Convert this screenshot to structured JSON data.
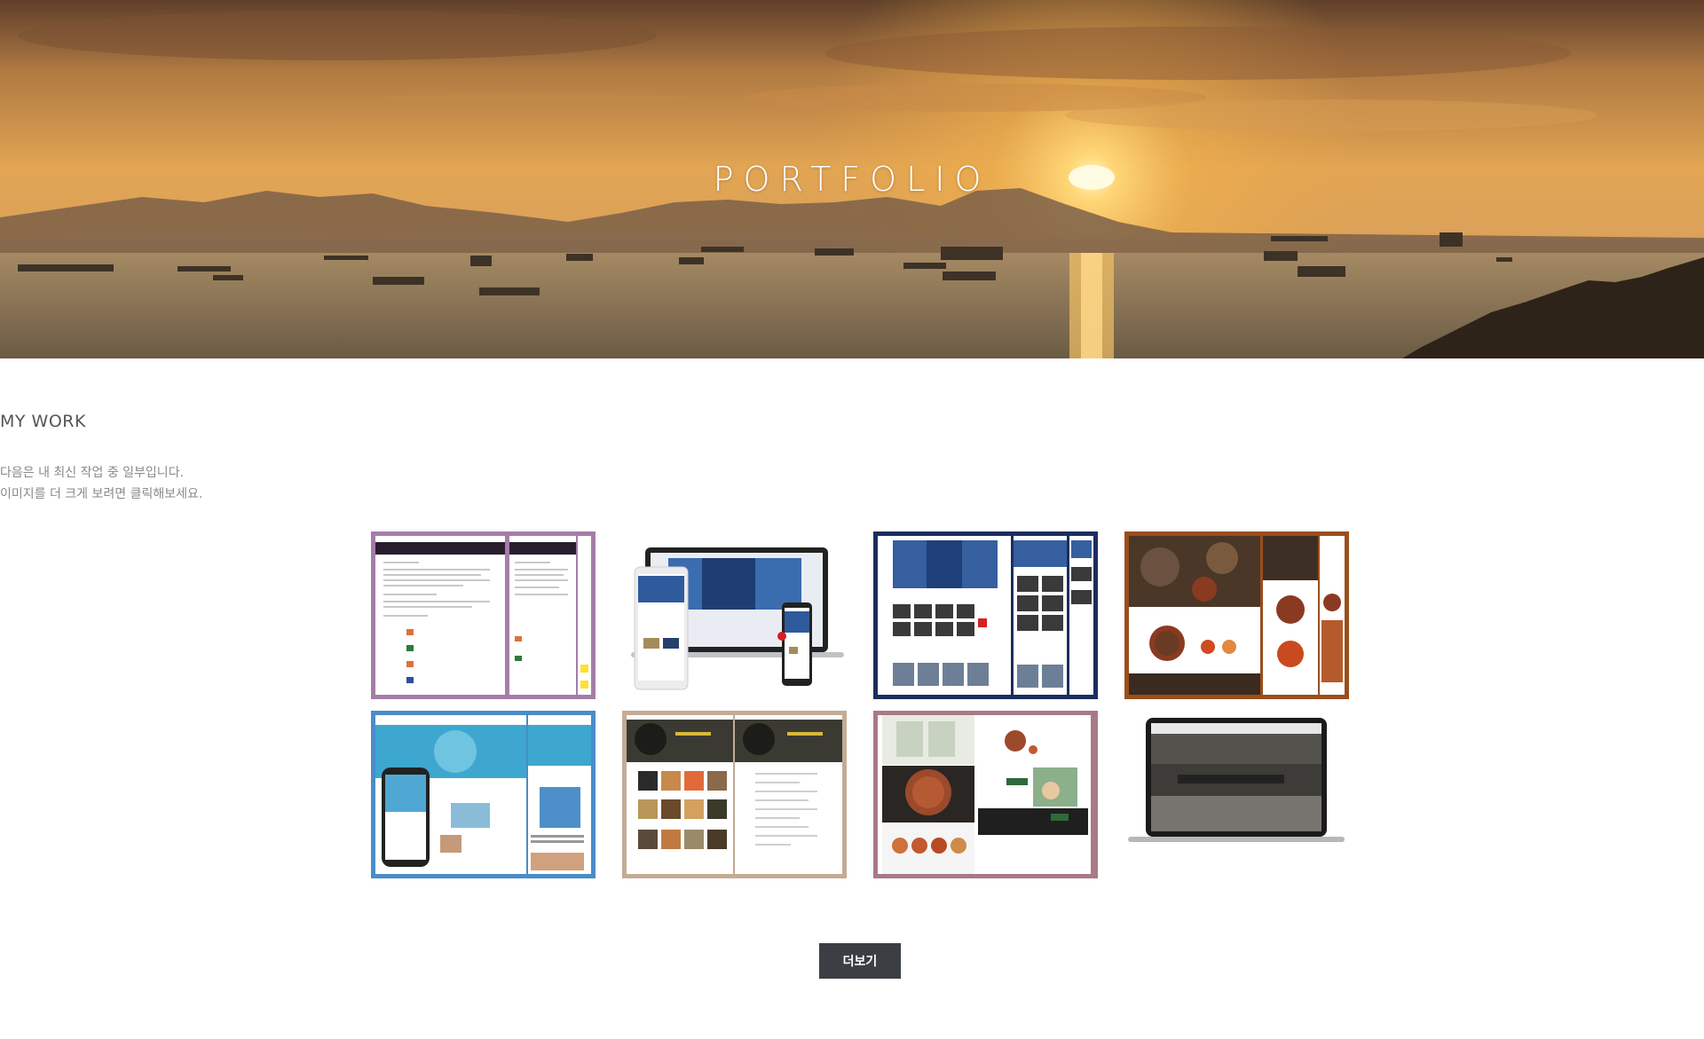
{
  "hero": {
    "title": "PORTFOLIO",
    "image": "sunset-sea-ships-photo"
  },
  "work": {
    "title": "MY WORK",
    "desc_line1": "다음은 내 최신 작업 중 일부입니다.",
    "desc_line2": "이미지를 더 크게 보려면 클릭해보세요."
  },
  "thumbnails": [
    {
      "name": "portfolio-thumb-purple-document",
      "frame_color": "#a57da8"
    },
    {
      "name": "portfolio-thumb-responsive-devices",
      "frame_color": "#ffffff"
    },
    {
      "name": "portfolio-thumb-navy-hospital",
      "frame_color": "#1c2d5e"
    },
    {
      "name": "portfolio-thumb-brown-food",
      "frame_color": "#9a4e1c"
    },
    {
      "name": "portfolio-thumb-blue-pool",
      "frame_color": "#4a8cc9"
    },
    {
      "name": "portfolio-thumb-beige-cafe",
      "frame_color": "#c4ab95"
    },
    {
      "name": "portfolio-thumb-mauve-restaurant",
      "frame_color": "#a97a86"
    },
    {
      "name": "portfolio-thumb-laptop-kitchen",
      "frame_color": "#ffffff"
    }
  ],
  "more_button": {
    "label": "더보기"
  }
}
